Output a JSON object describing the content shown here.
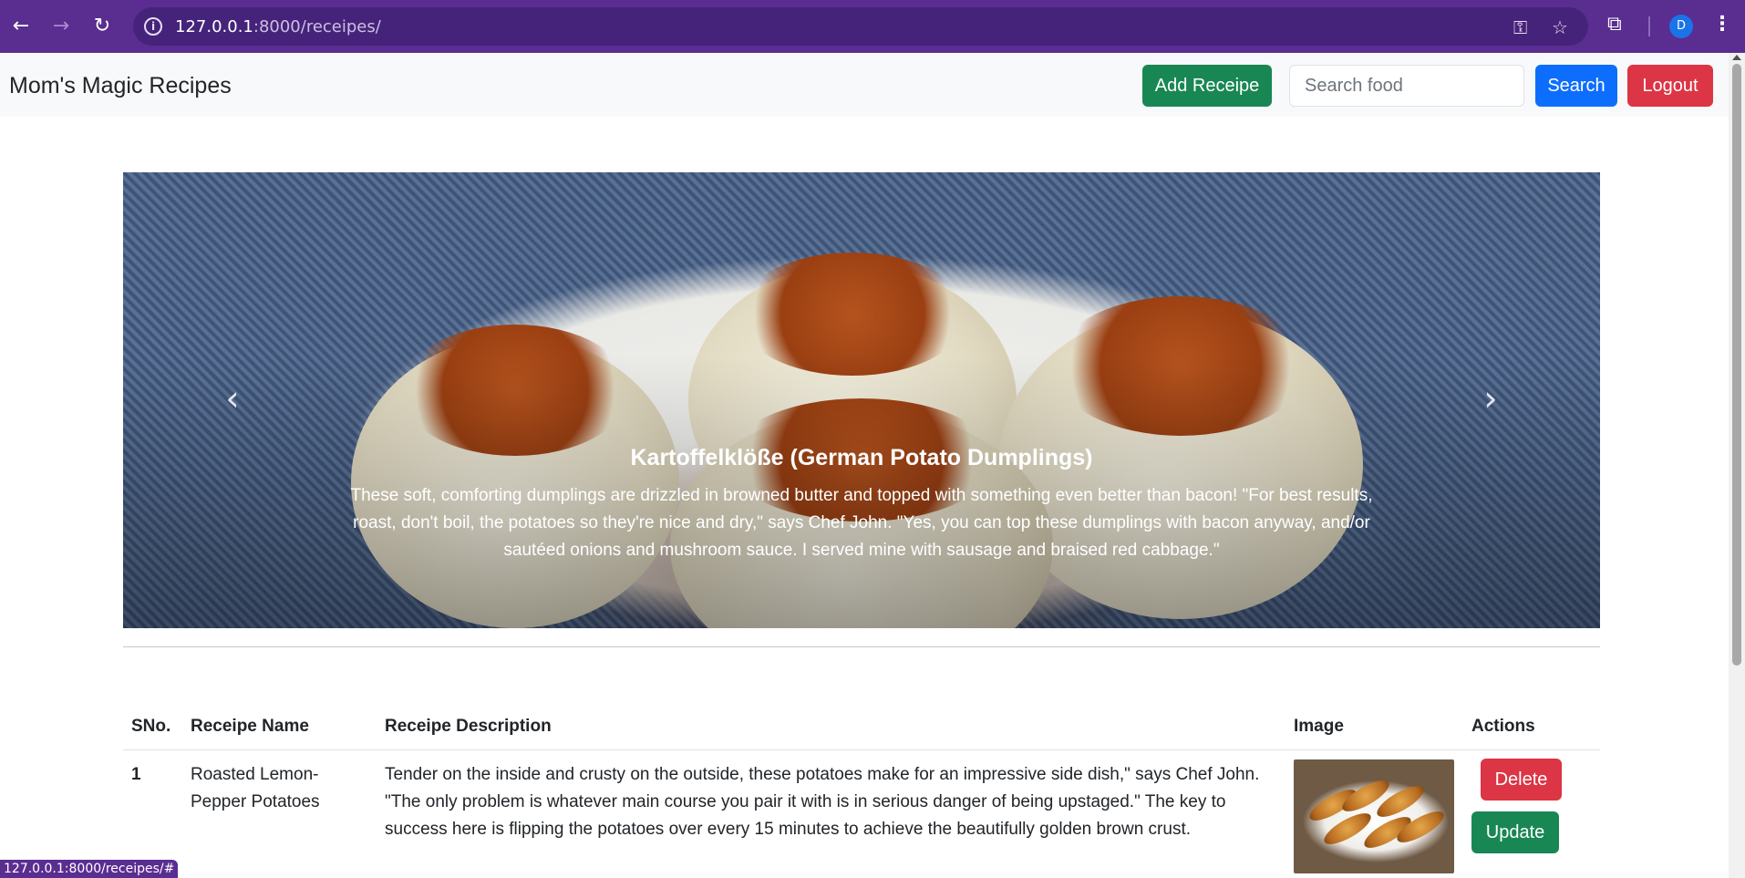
{
  "browser": {
    "url_host": "127.0.0.1",
    "url_path": ":8000/receipes/",
    "profile_initial": "D",
    "status_url": "127.0.0.1:8000/receipes/#"
  },
  "navbar": {
    "brand": "Mom's Magic Recipes",
    "add_label": "Add Receipe",
    "search_placeholder": "Search food",
    "search_label": "Search",
    "logout_label": "Logout"
  },
  "carousel": {
    "title": "Kartoffelklöße (German Potato Dumplings)",
    "description": "These soft, comforting dumplings are drizzled in browned butter and topped with something even better than bacon! \"For best results, roast, don't boil, the potatoes so they're nice and dry,\" says Chef John. \"Yes, you can top these dumplings with bacon anyway, and/or sautéed onions and mushroom sauce. I served mine with sausage and braised red cabbage.\""
  },
  "table": {
    "headers": {
      "sno": "SNo.",
      "name": "Receipe Name",
      "description": "Receipe Description",
      "image": "Image",
      "actions": "Actions"
    },
    "rows": [
      {
        "sno": "1",
        "name": "Roasted Lemon-Pepper Potatoes",
        "description": "Tender on the inside and crusty on the outside, these potatoes make for an impressive side dish,\" says Chef John. \"The only problem is whatever main course you pair it with is in serious danger of being upstaged.\" The key to success here is flipping the potatoes over every 15 minutes to achieve the beautifully golden brown crust.",
        "delete_label": "Delete",
        "update_label": "Update"
      }
    ]
  },
  "colors": {
    "browser_frame": "#5a2d91",
    "success": "#198754",
    "primary": "#0d6efd",
    "danger": "#dc3545"
  }
}
